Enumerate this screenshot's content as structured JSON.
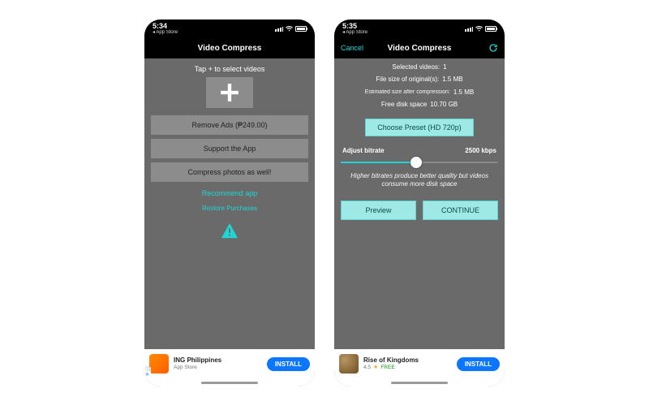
{
  "colors": {
    "accent": "#1fd6d6",
    "button_teal": "#9ee8e6",
    "install_blue": "#0b76ff"
  },
  "left": {
    "status": {
      "time": "5:34",
      "back_app": "◂ App Store"
    },
    "nav": {
      "title": "Video Compress"
    },
    "hint": "Tap + to select videos",
    "buttons": {
      "remove_ads": "Remove Ads (₱249.00)",
      "support": "Support the App",
      "compress_photos": "Compress photos as well!"
    },
    "links": {
      "recommend": "Recommend app",
      "restore": "Restore Purchases"
    },
    "ad": {
      "title": "ING Philippines",
      "subtitle": "App Store",
      "cta": "INSTALL"
    }
  },
  "right": {
    "status": {
      "time": "5:35",
      "back_app": "◂ App Store"
    },
    "nav": {
      "title": "Video Compress",
      "cancel": "Cancel"
    },
    "info": {
      "selected_label": "Selected videos:",
      "selected_value": "1",
      "orig_label": "File size of original(s):",
      "orig_value": "1.5 MB",
      "est_label": "Estimated size after compression:",
      "est_value": "1.5 MB",
      "free_label": "Free disk space",
      "free_value": "10.70 GB"
    },
    "preset_button": "Choose Preset (HD 720p)",
    "slider": {
      "label": "Adjust bitrate",
      "value_text": "2500 kbps",
      "hint": "Higher bitrates produce better quality but videos consume more disk space"
    },
    "actions": {
      "preview": "Preview",
      "continue": "CONTINUE"
    },
    "ad": {
      "title": "Rise of Kingdoms",
      "rating": "4.5",
      "price": "FREE",
      "cta": "INSTALL"
    }
  }
}
